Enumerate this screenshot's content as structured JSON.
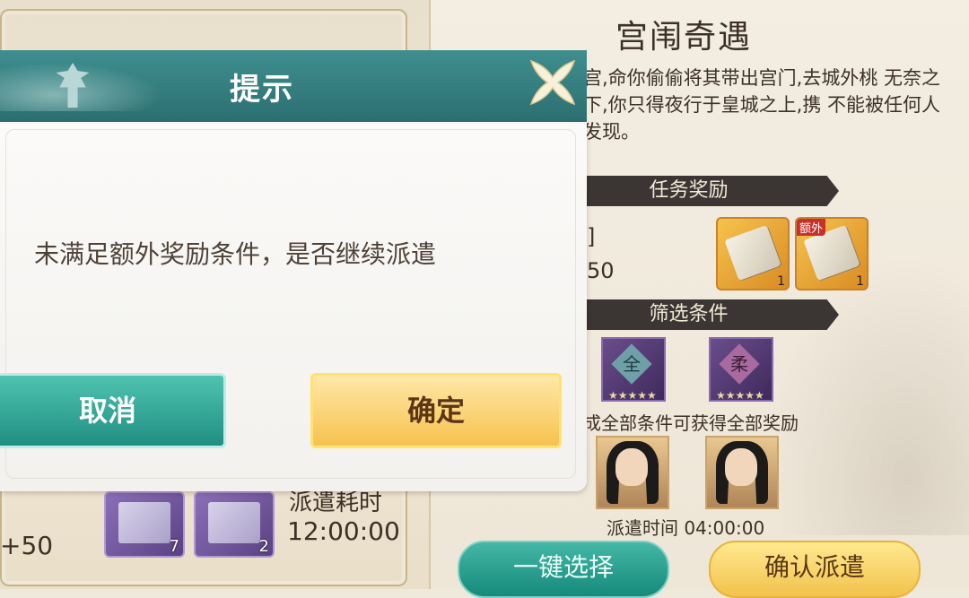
{
  "background_panel": {
    "title": "宫闱奇遇",
    "description": "宫,命你偷偷将其带出宫门,去城外桃 无奈之下,你只得夜行于皇城之上,携 不能被任何人发现。",
    "reward_section_label": "任务奖励",
    "reward_partial_text_1": "]",
    "reward_partial_text_2": "50",
    "reward_items": [
      {
        "count": "1",
        "extra": ""
      },
      {
        "count": "1",
        "extra": "额外"
      }
    ],
    "filter_section_label": "筛选条件",
    "condition_icons": [
      {
        "char": "全"
      },
      {
        "char": "柔"
      }
    ],
    "hint_text": "成全部条件可获得全部奖励",
    "dispatch_time_text": "派遣时间 04:00:00",
    "select_button": "一键选择",
    "confirm_dispatch_button": "确认派遣"
  },
  "left_panel": {
    "item_counts": [
      "7",
      "2"
    ],
    "dispatch_cost_label": "派遣耗时",
    "dispatch_cost_time": "12:00:00",
    "bonus_text": "+50"
  },
  "dialog": {
    "title": "提示",
    "message": "未满足额外奖励条件，是否继续派遣",
    "cancel_label": "取消",
    "confirm_label": "确定"
  }
}
